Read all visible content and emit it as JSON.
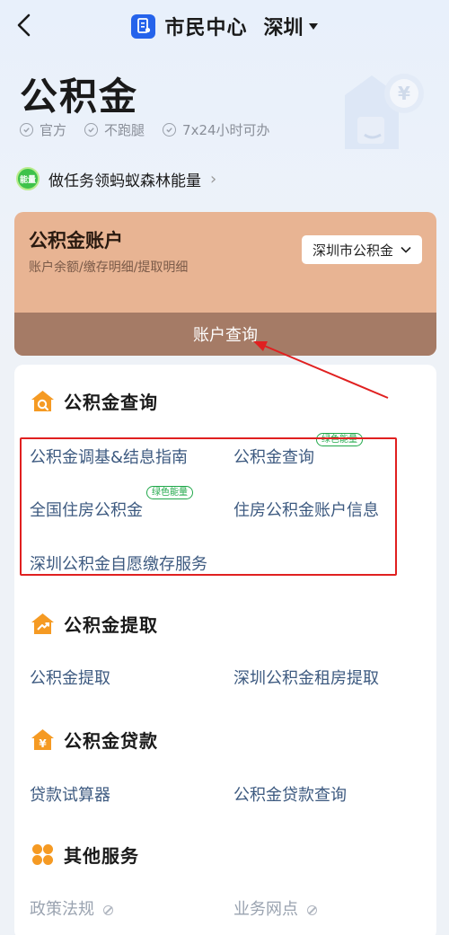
{
  "nav": {
    "app_name": "市民中心",
    "city": "深圳"
  },
  "page": {
    "title": "公积金",
    "tags": [
      "官方",
      "不跑腿",
      "7x24小时可办"
    ]
  },
  "energy_banner": {
    "badge": "能量",
    "text": "做任务领蚂蚁森林能量",
    "chevron": "›"
  },
  "account_card": {
    "title": "公积金账户",
    "subtitle": "账户余额/缴存明细/提取明细",
    "select_value": "深圳市公积金",
    "button": "账户查询"
  },
  "sections": {
    "query": {
      "title": "公积金查询",
      "items": [
        "公积金调基&结息指南",
        "公积金查询",
        "全国住房公积金",
        "住房公积金账户信息",
        "深圳公积金自愿缴存服务"
      ],
      "badges": [
        "绿色能量",
        "绿色能量"
      ]
    },
    "withdraw": {
      "title": "公积金提取",
      "items": [
        "公积金提取",
        "深圳公积金租房提取"
      ]
    },
    "loan": {
      "title": "公积金贷款",
      "items": [
        "贷款试算器",
        "公积金贷款查询"
      ]
    },
    "other": {
      "title": "其他服务",
      "items": [
        "政策法规",
        "业务网点"
      ]
    }
  },
  "colors": {
    "brand": "#2563eb",
    "card": "#e8b493",
    "card_button": "#a57b66",
    "link": "#3d5a80",
    "highlight": "#e02020",
    "energy": "#21a84a"
  },
  "icons": [
    "back-arrow-icon",
    "app-logo-icon",
    "dropdown-triangle-icon",
    "check-circle-icon",
    "wallet-yen-icon",
    "chevron-down-icon",
    "house-search-icon",
    "house-arrow-icon",
    "house-yen-icon",
    "grid-flower-icon",
    "disabled-icon"
  ]
}
